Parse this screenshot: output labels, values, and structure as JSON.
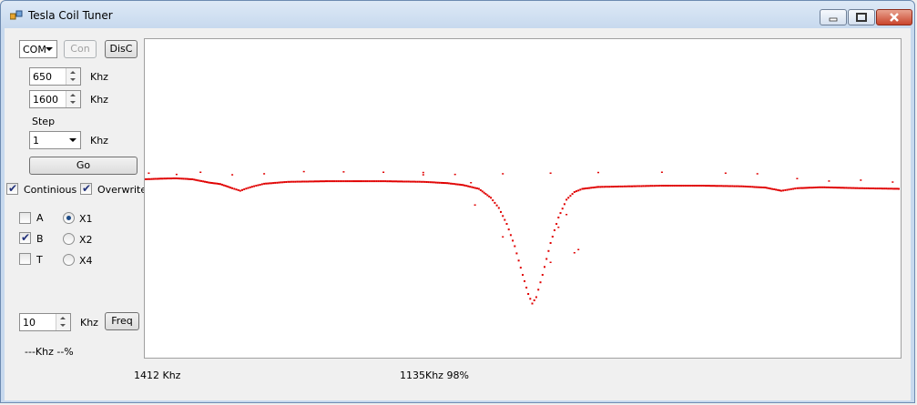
{
  "window": {
    "title": "Tesla Coil Tuner"
  },
  "connection": {
    "port": "COM",
    "connect_label": "Con",
    "disconnect_label": "DisC"
  },
  "sweep": {
    "start": "650",
    "end": "1600",
    "unit": "Khz",
    "step_label": "Step",
    "step": "1",
    "go_label": "Go"
  },
  "options": {
    "continuous_label": "Continious",
    "continuous": true,
    "overwrite_label": "Overwrite",
    "overwrite": true
  },
  "channels": [
    {
      "label": "A",
      "checked": false
    },
    {
      "label": "B",
      "checked": true
    },
    {
      "label": "T",
      "checked": false
    }
  ],
  "scale": [
    {
      "label": "X1",
      "selected": true
    },
    {
      "label": "X2",
      "selected": false
    },
    {
      "label": "X4",
      "selected": false
    }
  ],
  "freq": {
    "value": "10",
    "unit": "Khz",
    "button_label": "Freq",
    "readout": "---Khz --%"
  },
  "status": {
    "cursor": "1412 Khz",
    "resonance": "1135Khz 98%"
  },
  "chart_data": {
    "type": "scatter",
    "color": "#e00000",
    "x_unit": "Khz",
    "xlim": [
      650,
      1600
    ],
    "ylim": [
      0,
      100
    ],
    "series": [
      {
        "points": [
          [
            650,
            56
          ],
          [
            670,
            56.2
          ],
          [
            690,
            56.3
          ],
          [
            710,
            56
          ],
          [
            730,
            55
          ],
          [
            745,
            54.5
          ],
          [
            760,
            53.2
          ],
          [
            770,
            52.4
          ],
          [
            780,
            53.3
          ],
          [
            790,
            54
          ],
          [
            800,
            54.6
          ],
          [
            830,
            55.2
          ],
          [
            880,
            55.4
          ],
          [
            950,
            55.4
          ],
          [
            1000,
            55.2
          ],
          [
            1030,
            54.8
          ],
          [
            1050,
            54.2
          ],
          [
            1070,
            53
          ],
          [
            1085,
            50.2
          ],
          [
            1095,
            47
          ],
          [
            1105,
            42
          ],
          [
            1115,
            35
          ],
          [
            1125,
            26
          ],
          [
            1132,
            20
          ],
          [
            1137,
            17
          ],
          [
            1142,
            19
          ],
          [
            1150,
            26
          ],
          [
            1160,
            36
          ],
          [
            1170,
            44
          ],
          [
            1180,
            49.6
          ],
          [
            1190,
            52
          ],
          [
            1200,
            53
          ],
          [
            1220,
            53.6
          ],
          [
            1260,
            53.8
          ],
          [
            1300,
            54
          ],
          [
            1350,
            54
          ],
          [
            1400,
            53.8
          ],
          [
            1430,
            53.4
          ],
          [
            1450,
            52.4
          ],
          [
            1460,
            52.8
          ],
          [
            1470,
            53.2
          ],
          [
            1500,
            53.5
          ],
          [
            1550,
            53.2
          ],
          [
            1600,
            53
          ]
        ]
      },
      {
        "points": [
          [
            655,
            58
          ],
          [
            690,
            57.6
          ],
          [
            720,
            58.3
          ],
          [
            760,
            57.5
          ],
          [
            800,
            57.8
          ],
          [
            850,
            58.5
          ],
          [
            900,
            58.4
          ],
          [
            950,
            58.3
          ],
          [
            1000,
            58.2
          ],
          [
            1040,
            57.6
          ],
          [
            1100,
            57.8
          ],
          [
            1160,
            58
          ],
          [
            1220,
            58.2
          ],
          [
            1300,
            58.3
          ],
          [
            1380,
            58
          ],
          [
            1420,
            57.8
          ],
          [
            1470,
            56.3
          ],
          [
            1510,
            55.5
          ],
          [
            1550,
            55.8
          ],
          [
            1590,
            55.2
          ],
          [
            1000,
            57.5
          ],
          [
            1060,
            55
          ],
          [
            1065,
            48
          ],
          [
            1100,
            38
          ],
          [
            1180,
            45
          ],
          [
            1170,
            41
          ],
          [
            1190,
            33
          ],
          [
            1160,
            30
          ],
          [
            1195,
            34
          ]
        ]
      }
    ]
  }
}
